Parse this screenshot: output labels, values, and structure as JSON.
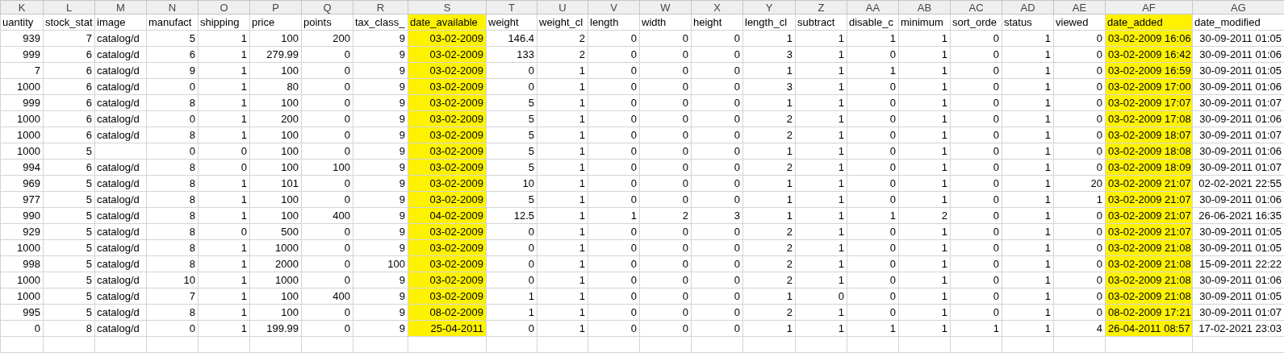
{
  "columns": [
    {
      "letter": "K",
      "name": "uantity",
      "kind": "number",
      "highlighted": false
    },
    {
      "letter": "L",
      "name": "stock_stat",
      "kind": "number",
      "highlighted": false
    },
    {
      "letter": "M",
      "name": "image",
      "kind": "text",
      "highlighted": false
    },
    {
      "letter": "N",
      "name": "manufact",
      "kind": "number",
      "highlighted": false
    },
    {
      "letter": "O",
      "name": "shipping",
      "kind": "number",
      "highlighted": false
    },
    {
      "letter": "P",
      "name": "price",
      "kind": "number",
      "highlighted": false
    },
    {
      "letter": "Q",
      "name": "points",
      "kind": "number",
      "highlighted": false
    },
    {
      "letter": "R",
      "name": "tax_class_",
      "kind": "number",
      "highlighted": false
    },
    {
      "letter": "S",
      "name": "date_available",
      "kind": "number",
      "highlighted": true
    },
    {
      "letter": "T",
      "name": "weight",
      "kind": "number",
      "highlighted": false
    },
    {
      "letter": "U",
      "name": "weight_cl",
      "kind": "number",
      "highlighted": false
    },
    {
      "letter": "V",
      "name": "length",
      "kind": "number",
      "highlighted": false
    },
    {
      "letter": "W",
      "name": "width",
      "kind": "number",
      "highlighted": false
    },
    {
      "letter": "X",
      "name": "height",
      "kind": "number",
      "highlighted": false
    },
    {
      "letter": "Y",
      "name": "length_cl",
      "kind": "number",
      "highlighted": false
    },
    {
      "letter": "Z",
      "name": "subtract",
      "kind": "number",
      "highlighted": false
    },
    {
      "letter": "AA",
      "name": "disable_c",
      "kind": "number",
      "highlighted": false
    },
    {
      "letter": "AB",
      "name": "minimum",
      "kind": "number",
      "highlighted": false
    },
    {
      "letter": "AC",
      "name": "sort_orde",
      "kind": "number",
      "highlighted": false
    },
    {
      "letter": "AD",
      "name": "status",
      "kind": "number",
      "highlighted": false
    },
    {
      "letter": "AE",
      "name": "viewed",
      "kind": "number",
      "highlighted": false
    },
    {
      "letter": "AF",
      "name": "date_added",
      "kind": "number",
      "highlighted": true
    },
    {
      "letter": "AG",
      "name": "date_modified",
      "kind": "number",
      "highlighted": false
    }
  ],
  "rows": [
    [
      "939",
      "7",
      "catalog/d",
      "5",
      "1",
      "100",
      "200",
      "9",
      "03-02-2009",
      "146.4",
      "2",
      "0",
      "0",
      "0",
      "1",
      "1",
      "1",
      "1",
      "0",
      "1",
      "0",
      "03-02-2009 16:06",
      "30-09-2011 01:05"
    ],
    [
      "999",
      "6",
      "catalog/d",
      "6",
      "1",
      "279.99",
      "0",
      "9",
      "03-02-2009",
      "133",
      "2",
      "0",
      "0",
      "0",
      "3",
      "1",
      "0",
      "1",
      "0",
      "1",
      "0",
      "03-02-2009 16:42",
      "30-09-2011 01:06"
    ],
    [
      "7",
      "6",
      "catalog/d",
      "9",
      "1",
      "100",
      "0",
      "9",
      "03-02-2009",
      "0",
      "1",
      "0",
      "0",
      "0",
      "1",
      "1",
      "1",
      "1",
      "0",
      "1",
      "0",
      "03-02-2009 16:59",
      "30-09-2011 01:05"
    ],
    [
      "1000",
      "6",
      "catalog/d",
      "0",
      "1",
      "80",
      "0",
      "9",
      "03-02-2009",
      "0",
      "1",
      "0",
      "0",
      "0",
      "3",
      "1",
      "0",
      "1",
      "0",
      "1",
      "0",
      "03-02-2009 17:00",
      "30-09-2011 01:06"
    ],
    [
      "999",
      "6",
      "catalog/d",
      "8",
      "1",
      "100",
      "0",
      "9",
      "03-02-2009",
      "5",
      "1",
      "0",
      "0",
      "0",
      "1",
      "1",
      "0",
      "1",
      "0",
      "1",
      "0",
      "03-02-2009 17:07",
      "30-09-2011 01:07"
    ],
    [
      "1000",
      "6",
      "catalog/d",
      "0",
      "1",
      "200",
      "0",
      "9",
      "03-02-2009",
      "5",
      "1",
      "0",
      "0",
      "0",
      "2",
      "1",
      "0",
      "1",
      "0",
      "1",
      "0",
      "03-02-2009 17:08",
      "30-09-2011 01:06"
    ],
    [
      "1000",
      "6",
      "catalog/d",
      "8",
      "1",
      "100",
      "0",
      "9",
      "03-02-2009",
      "5",
      "1",
      "0",
      "0",
      "0",
      "2",
      "1",
      "0",
      "1",
      "0",
      "1",
      "0",
      "03-02-2009 18:07",
      "30-09-2011 01:07"
    ],
    [
      "1000",
      "5",
      null,
      "0",
      "0",
      "100",
      "0",
      "9",
      "03-02-2009",
      "5",
      "1",
      "0",
      "0",
      "0",
      "1",
      "1",
      "0",
      "1",
      "0",
      "1",
      "0",
      "03-02-2009 18:08",
      "30-09-2011 01:06"
    ],
    [
      "994",
      "6",
      "catalog/d",
      "8",
      "0",
      "100",
      "100",
      "9",
      "03-02-2009",
      "5",
      "1",
      "0",
      "0",
      "0",
      "2",
      "1",
      "0",
      "1",
      "0",
      "1",
      "0",
      "03-02-2009 18:09",
      "30-09-2011 01:07"
    ],
    [
      "969",
      "5",
      "catalog/d",
      "8",
      "1",
      "101",
      "0",
      "9",
      "03-02-2009",
      "10",
      "1",
      "0",
      "0",
      "0",
      "1",
      "1",
      "0",
      "1",
      "0",
      "1",
      "20",
      "03-02-2009 21:07",
      "02-02-2021 22:55"
    ],
    [
      "977",
      "5",
      "catalog/d",
      "8",
      "1",
      "100",
      "0",
      "9",
      "03-02-2009",
      "5",
      "1",
      "0",
      "0",
      "0",
      "1",
      "1",
      "0",
      "1",
      "0",
      "1",
      "1",
      "03-02-2009 21:07",
      "30-09-2011 01:06"
    ],
    [
      "990",
      "5",
      "catalog/d",
      "8",
      "1",
      "100",
      "400",
      "9",
      "04-02-2009",
      "12.5",
      "1",
      "1",
      "2",
      "3",
      "1",
      "1",
      "1",
      "2",
      "0",
      "1",
      "0",
      "03-02-2009 21:07",
      "26-06-2021 16:35"
    ],
    [
      "929",
      "5",
      "catalog/d",
      "8",
      "0",
      "500",
      "0",
      "9",
      "03-02-2009",
      "0",
      "1",
      "0",
      "0",
      "0",
      "2",
      "1",
      "0",
      "1",
      "0",
      "1",
      "0",
      "03-02-2009 21:07",
      "30-09-2011 01:05"
    ],
    [
      "1000",
      "5",
      "catalog/d",
      "8",
      "1",
      "1000",
      "0",
      "9",
      "03-02-2009",
      "0",
      "1",
      "0",
      "0",
      "0",
      "2",
      "1",
      "0",
      "1",
      "0",
      "1",
      "0",
      "03-02-2009 21:08",
      "30-09-2011 01:05"
    ],
    [
      "998",
      "5",
      "catalog/d",
      "8",
      "1",
      "2000",
      "0",
      "100",
      "03-02-2009",
      "0",
      "1",
      "0",
      "0",
      "0",
      "2",
      "1",
      "0",
      "1",
      "0",
      "1",
      "0",
      "03-02-2009 21:08",
      "15-09-2011 22:22"
    ],
    [
      "1000",
      "5",
      "catalog/d",
      "10",
      "1",
      "1000",
      "0",
      "9",
      "03-02-2009",
      "0",
      "1",
      "0",
      "0",
      "0",
      "2",
      "1",
      "0",
      "1",
      "0",
      "1",
      "0",
      "03-02-2009 21:08",
      "30-09-2011 01:06"
    ],
    [
      "1000",
      "5",
      "catalog/d",
      "7",
      "1",
      "100",
      "400",
      "9",
      "03-02-2009",
      "1",
      "1",
      "0",
      "0",
      "0",
      "1",
      "0",
      "0",
      "1",
      "0",
      "1",
      "0",
      "03-02-2009 21:08",
      "30-09-2011 01:05"
    ],
    [
      "995",
      "5",
      "catalog/d",
      "8",
      "1",
      "100",
      "0",
      "9",
      "08-02-2009",
      "1",
      "1",
      "0",
      "0",
      "0",
      "2",
      "1",
      "0",
      "1",
      "0",
      "1",
      "0",
      "08-02-2009 17:21",
      "30-09-2011 01:07"
    ],
    [
      "0",
      "8",
      "catalog/d",
      "0",
      "1",
      "199.99",
      "0",
      "9",
      "25-04-2011",
      "0",
      "1",
      "0",
      "0",
      "0",
      "1",
      "1",
      "1",
      "1",
      "1",
      "1",
      "4",
      "26-04-2011 08:57",
      "17-02-2021 23:03"
    ]
  ]
}
